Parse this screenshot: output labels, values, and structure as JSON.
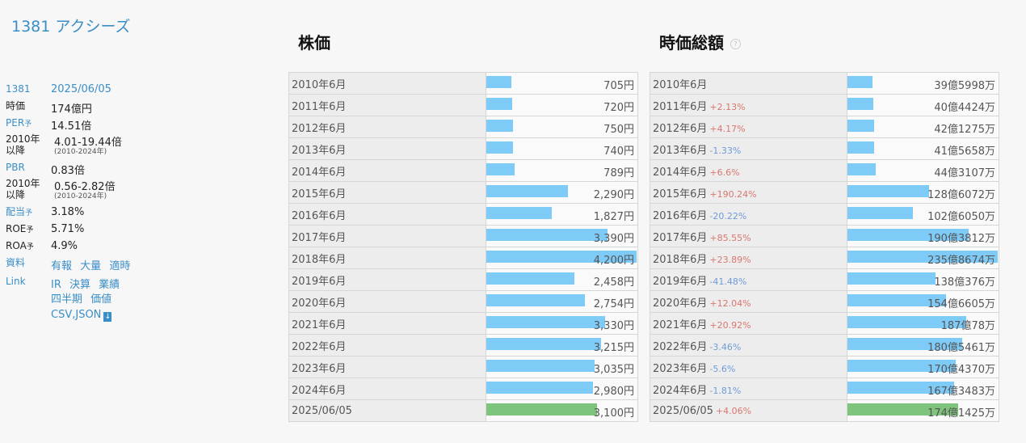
{
  "company": {
    "title": "1381 アクシーズ"
  },
  "info": {
    "code": "1381",
    "date": "2025/06/05",
    "market_cap_label": "時価",
    "market_cap": "174億円",
    "per_label": "PER",
    "per": "14.51倍",
    "per_range_label": "2010年以降",
    "per_range": "4.01-19.44倍",
    "per_range_note": "(2010-2024年)",
    "pbr_label": "PBR",
    "pbr": "0.83倍",
    "pbr_range_label": "2010年以降",
    "pbr_range": "0.56-2.82倍",
    "pbr_range_note": "(2010-2024年)",
    "dividend_label": "配当",
    "dividend": "3.18%",
    "roe_label": "ROE",
    "roe": "5.71%",
    "roa_label": "ROA",
    "roa": "4.9%",
    "forecast_mark": "予",
    "docs_label": "資料",
    "docs_links": [
      "有報",
      "大量",
      "適時"
    ],
    "link_label": "Link",
    "link_links": [
      "IR",
      "決算",
      "業績"
    ],
    "link_links2": [
      "四半期",
      "価値"
    ],
    "csv_json": "CSV,JSON"
  },
  "stock_price": {
    "title": "株価",
    "rows": [
      {
        "label": "2010年6月",
        "value": "705円",
        "ratio": 0.168
      },
      {
        "label": "2011年6月",
        "value": "720円",
        "ratio": 0.171
      },
      {
        "label": "2012年6月",
        "value": "750円",
        "ratio": 0.179
      },
      {
        "label": "2013年6月",
        "value": "740円",
        "ratio": 0.176
      },
      {
        "label": "2014年6月",
        "value": "789円",
        "ratio": 0.188
      },
      {
        "label": "2015年6月",
        "value": "2,290円",
        "ratio": 0.545
      },
      {
        "label": "2016年6月",
        "value": "1,827円",
        "ratio": 0.435
      },
      {
        "label": "2017年6月",
        "value": "3,390円",
        "ratio": 0.807
      },
      {
        "label": "2018年6月",
        "value": "4,200円",
        "ratio": 1.0
      },
      {
        "label": "2019年6月",
        "value": "2,458円",
        "ratio": 0.585
      },
      {
        "label": "2020年6月",
        "value": "2,754円",
        "ratio": 0.656
      },
      {
        "label": "2021年6月",
        "value": "3,330円",
        "ratio": 0.793
      },
      {
        "label": "2022年6月",
        "value": "3,215円",
        "ratio": 0.765
      },
      {
        "label": "2023年6月",
        "value": "3,035円",
        "ratio": 0.723
      },
      {
        "label": "2024年6月",
        "value": "2,980円",
        "ratio": 0.71
      },
      {
        "label": "2025/06/05",
        "value": "3,100円",
        "ratio": 0.738,
        "current": true
      }
    ]
  },
  "market_cap": {
    "title": "時価総額",
    "help": "?",
    "rows": [
      {
        "label": "2010年6月",
        "change": "",
        "dir": "",
        "value": "39億5998万",
        "ratio": 0.168
      },
      {
        "label": "2011年6月",
        "change": "+2.13%",
        "dir": "up",
        "value": "40億4424万",
        "ratio": 0.171
      },
      {
        "label": "2012年6月",
        "change": "+4.17%",
        "dir": "up",
        "value": "42億1275万",
        "ratio": 0.179
      },
      {
        "label": "2013年6月",
        "change": "-1.33%",
        "dir": "down",
        "value": "41億5658万",
        "ratio": 0.176
      },
      {
        "label": "2014年6月",
        "change": "+6.6%",
        "dir": "up",
        "value": "44億3107万",
        "ratio": 0.188
      },
      {
        "label": "2015年6月",
        "change": "+190.24%",
        "dir": "up",
        "value": "128億6072万",
        "ratio": 0.545
      },
      {
        "label": "2016年6月",
        "change": "-20.22%",
        "dir": "down",
        "value": "102億6050万",
        "ratio": 0.435
      },
      {
        "label": "2017年6月",
        "change": "+85.55%",
        "dir": "up",
        "value": "190億3812万",
        "ratio": 0.807
      },
      {
        "label": "2018年6月",
        "change": "+23.89%",
        "dir": "up",
        "value": "235億8674万",
        "ratio": 1.0
      },
      {
        "label": "2019年6月",
        "change": "-41.48%",
        "dir": "down",
        "value": "138億376万",
        "ratio": 0.585
      },
      {
        "label": "2020年6月",
        "change": "+12.04%",
        "dir": "up",
        "value": "154億6605万",
        "ratio": 0.656
      },
      {
        "label": "2021年6月",
        "change": "+20.92%",
        "dir": "up",
        "value": "187億78万",
        "ratio": 0.793
      },
      {
        "label": "2022年6月",
        "change": "-3.46%",
        "dir": "down",
        "value": "180億5461万",
        "ratio": 0.765
      },
      {
        "label": "2023年6月",
        "change": "-5.6%",
        "dir": "down",
        "value": "170億4370万",
        "ratio": 0.723
      },
      {
        "label": "2024年6月",
        "change": "-1.81%",
        "dir": "down",
        "value": "167億3483万",
        "ratio": 0.71
      },
      {
        "label": "2025/06/05",
        "change": "+4.06%",
        "dir": "up",
        "value": "174億1425万",
        "ratio": 0.738,
        "current": true
      }
    ]
  },
  "colors": {
    "bar": "#7ecbf7",
    "bar_current": "#7fc47c",
    "link": "#3a8ec8",
    "up": "#d9776f",
    "down": "#6f9bd9"
  }
}
